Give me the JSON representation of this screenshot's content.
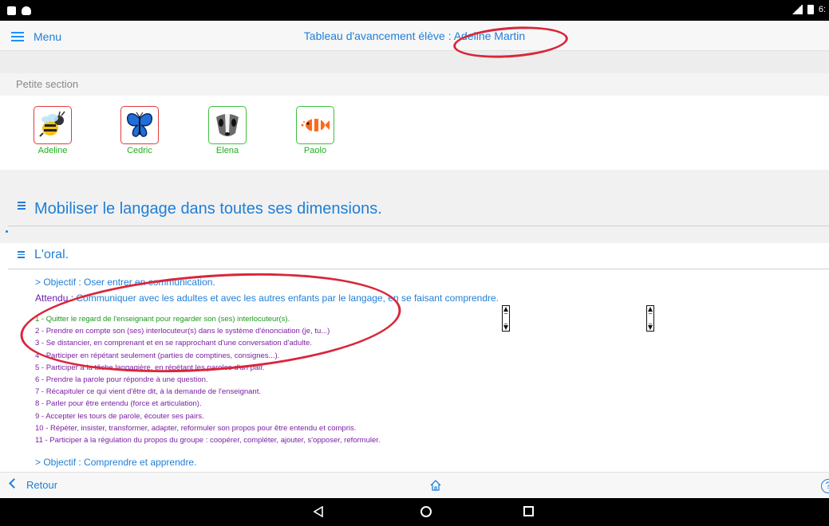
{
  "status_bar": {
    "time": "6:"
  },
  "header": {
    "menu_label": "Menu",
    "title": "Tableau d'avancement élève : Adeline Martin"
  },
  "section_label": "Petite section",
  "students": [
    {
      "name": "Adeline",
      "icon": "bee-icon",
      "border": "#e23b3b"
    },
    {
      "name": "Cedric",
      "icon": "butterfly-icon",
      "border": "#e23b3b"
    },
    {
      "name": "Elena",
      "icon": "badger-icon",
      "border": "#3fbf3f"
    },
    {
      "name": "Paolo",
      "icon": "clownfish-icon",
      "border": "#3fbf3f"
    }
  ],
  "domain_heading": "Mobiliser le langage dans toutes ses dimensions.",
  "subdomain_heading": "L'oral.",
  "objective_1": "> Objectif : Oser entrer en communication.",
  "attendu_prefix": "Attendu : ",
  "attendu_text": "Communiquer avec les adultes et avec les autres enfants par le langage, en se faisant comprendre.",
  "items": [
    "1 - Quitter le regard de l'enseignant pour regarder son (ses) interlocuteur(s).",
    "2 - Prendre en compte son (ses) interlocuteur(s) dans le système d'énonciation (je, tu...)",
    "3 - Se distancier, en comprenant et en se rapprochant d'une conversation d'adulte.",
    "4 - Participer en répétant seulement (parties de comptines, consignes...).",
    "5 - Participer à la tâche langagière, en répétant les paroles d'un pair.",
    "6 - Prendre la parole pour répondre à une question.",
    "7 - Récapituler ce qui vient d'être dit, à la demande de l'enseignant.",
    "8 - Parler pour être entendu (force et articulation).",
    "9 - Accepter les tours de parole, écouter ses pairs.",
    "10 - Répéter, insister, transformer, adapter, reformuler son propos pour être entendu et compris.",
    "11 - Participer à la régulation du propos du groupe : coopérer, compléter, ajouter, s'opposer, reformuler."
  ],
  "objective_2": "> Objectif : Comprendre et apprendre.",
  "footer": {
    "back_label": "Retour",
    "help_label": "?"
  },
  "colors": {
    "accent": "#1e7fd8",
    "green": "#1fae1f",
    "purple": "#7b1fa2",
    "annotation": "#d9263a"
  }
}
